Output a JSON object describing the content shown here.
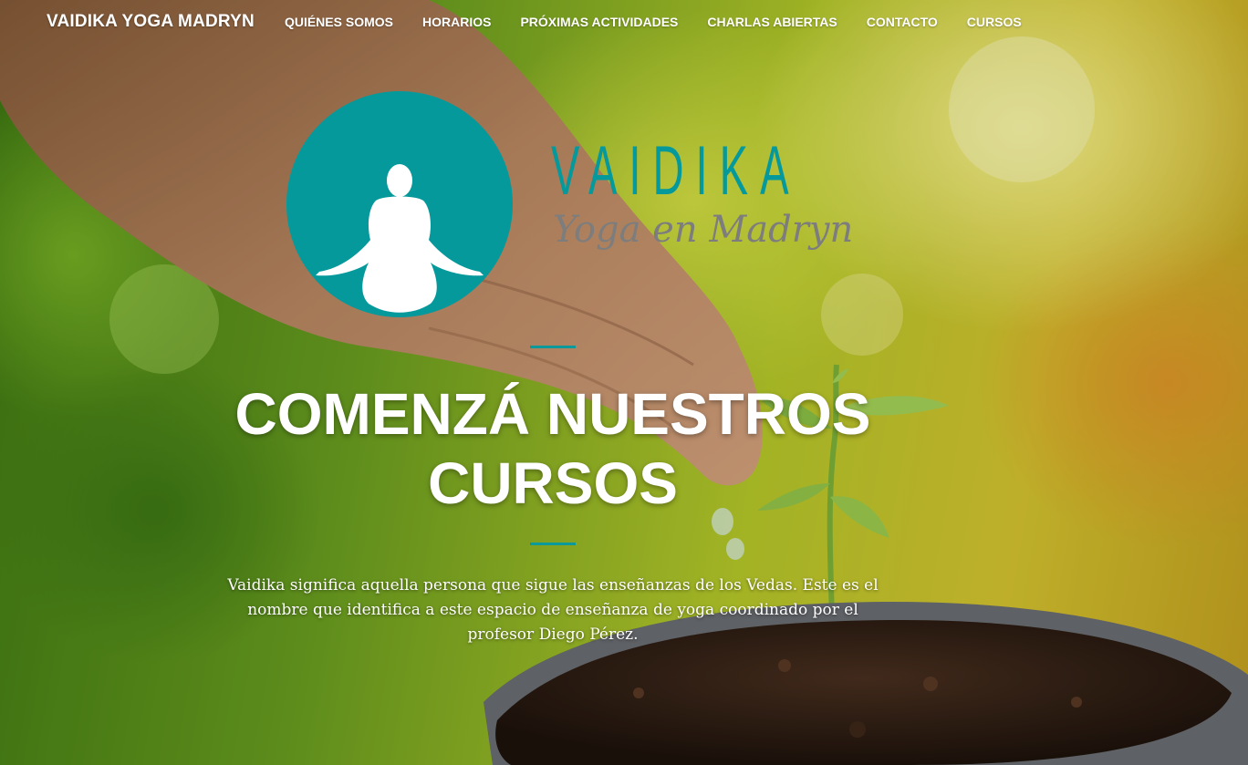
{
  "nav": {
    "brand": "VAIDIKA YOGA MADRYN",
    "items": [
      {
        "label": "QUIÉNES SOMOS"
      },
      {
        "label": "HORARIOS"
      },
      {
        "label": "PRÓXIMAS ACTIVIDADES"
      },
      {
        "label": "CHARLAS ABIERTAS"
      },
      {
        "label": "CONTACTO"
      },
      {
        "label": "CURSOS"
      }
    ]
  },
  "logo": {
    "word": "VAIDIKA",
    "subtitle": "Yoga en Madryn",
    "icon": "meditating-figure-icon",
    "color": "#06999c"
  },
  "hero": {
    "headline": "COMENZÁ NUESTROS CURSOS",
    "lead": "Vaidika significa aquella persona que sigue las enseñanzas de los Vedas. Este es el nombre que identifica a este espacio de enseñanza de yoga coordinado por el profesor Diego Pérez.",
    "accent_color": "#0a9a9c",
    "background_image": "hand-watering-seedling"
  }
}
